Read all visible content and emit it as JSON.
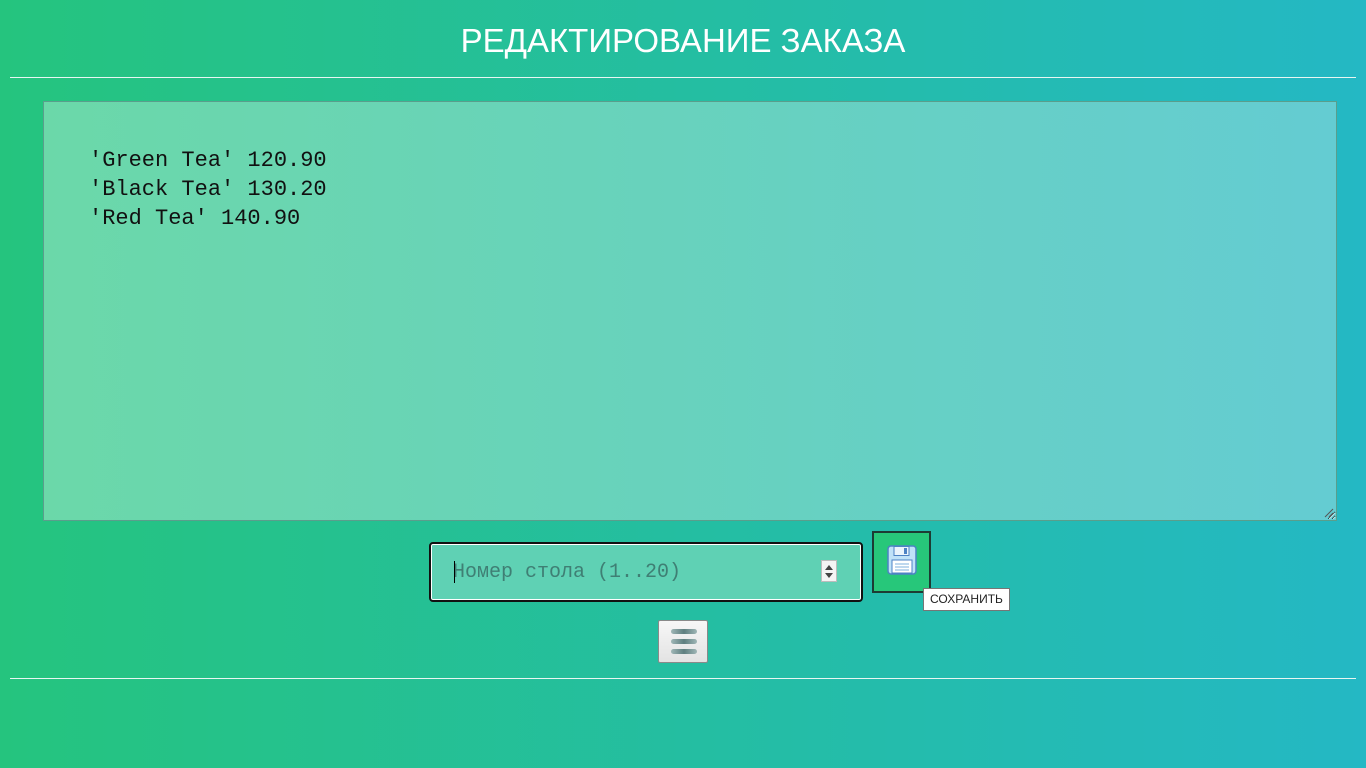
{
  "header": {
    "title": "РЕДАКТИРОВАНИЕ ЗАКАЗА"
  },
  "order": {
    "text": "'Green Tea' 120.90\n'Black Tea' 130.20\n'Red Tea' 140.90"
  },
  "table_number": {
    "value": "",
    "placeholder": "Номер стола (1..20)",
    "min": "1",
    "max": "20"
  },
  "save": {
    "icon": "floppy-disk-icon",
    "tooltip": "СОХРАНИТЬ"
  },
  "menu": {
    "icon": "hamburger-menu-icon"
  },
  "colors": {
    "background_start": "#25c47e",
    "background_end": "#24b8c4",
    "save_button": "#27c77a"
  }
}
